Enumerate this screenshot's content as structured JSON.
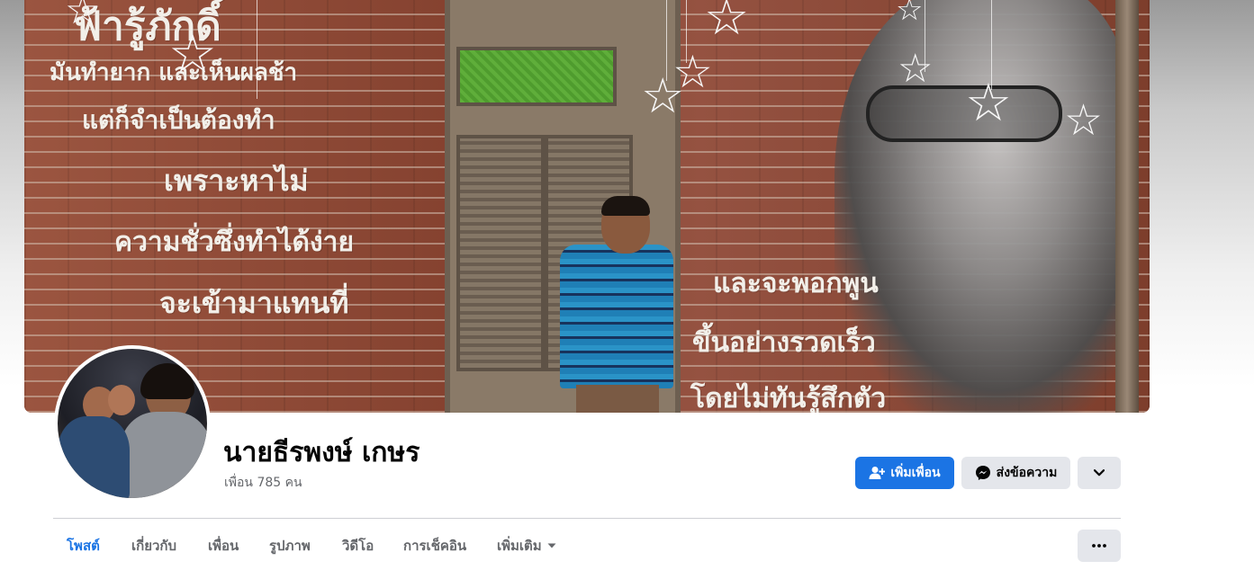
{
  "cover": {
    "mural_lines_left": [
      "ฟ้ารู้ภักดิ์",
      "มันทำยาก และเห็นผลช้า",
      "แต่ก็จำเป็นต้องทำ",
      "เพราะหาไม่",
      "ความชั่วซึ่งทำได้ง่าย",
      "จะเข้ามาแทนที่"
    ],
    "mural_lines_right": [
      "และจะพอกพูน",
      "ขึ้นอย่างรวดเร็ว",
      "โดยไม่ทันรู้สึกตัว"
    ]
  },
  "profile": {
    "name": "นายธีรพงษ์ เกษร",
    "friends_count": "เพื่อน 785 คน"
  },
  "actions": {
    "add_friend_label": "เพิ่มเพื่อน",
    "message_label": "ส่งข้อความ",
    "more_icon": "chevron-down-icon"
  },
  "tabs": [
    {
      "label": "โพสต์",
      "active": true
    },
    {
      "label": "เกี่ยวกับ",
      "active": false
    },
    {
      "label": "เพื่อน",
      "active": false
    },
    {
      "label": "รูปภาพ",
      "active": false
    },
    {
      "label": "วิดีโอ",
      "active": false
    },
    {
      "label": "การเช็คอิน",
      "active": false
    },
    {
      "label": "เพิ่มเติม",
      "active": false
    }
  ],
  "colors": {
    "accent": "#1b74e4",
    "secondary_button": "#e4e6eb",
    "text_primary": "#050505",
    "text_secondary": "#65676b"
  }
}
